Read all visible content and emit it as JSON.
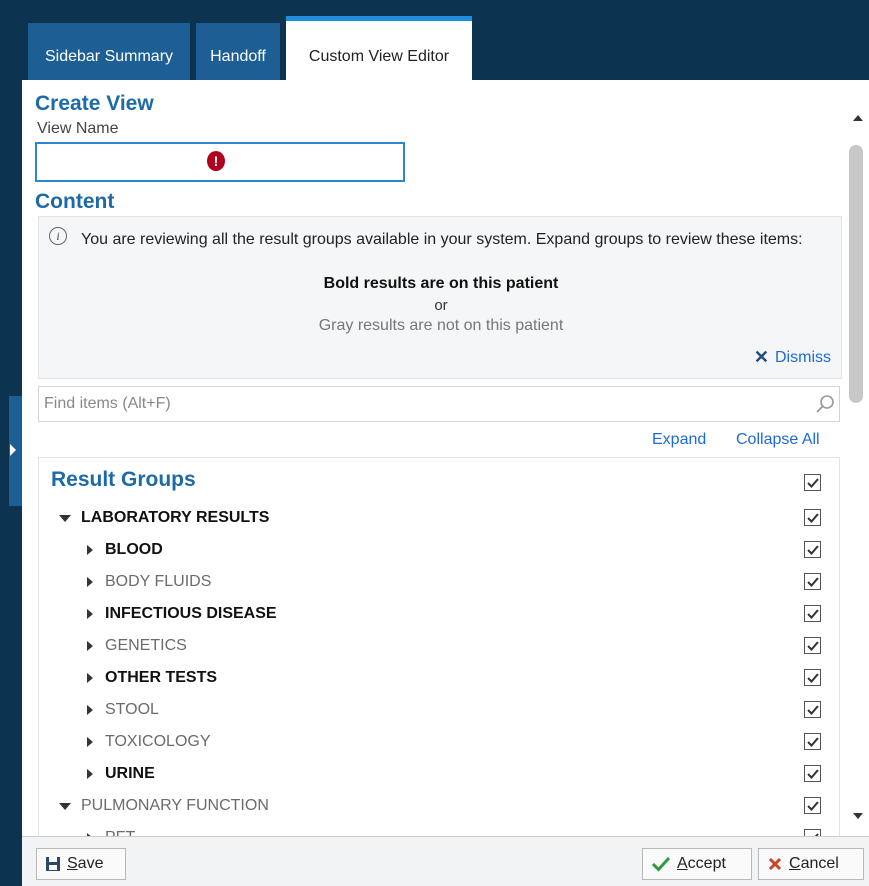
{
  "tabs": [
    {
      "label": "Sidebar Summary"
    },
    {
      "label": "Handoff"
    },
    {
      "label": "Custom View Editor"
    }
  ],
  "create_view": {
    "heading": "Create View",
    "view_name_label": "View Name",
    "view_name_value": "",
    "error_icon": "!"
  },
  "content": {
    "heading": "Content",
    "info_icon": "i",
    "info_text": "You are reviewing all the result groups available in your system. Expand groups to review these items:",
    "bold_note": "Bold results are on this patient",
    "or_text": "or",
    "gray_note": "Gray results are not on this patient",
    "dismiss_label": "Dismiss"
  },
  "search": {
    "placeholder": "Find items (Alt+F)"
  },
  "links": {
    "expand": "Expand",
    "collapse_all": "Collapse All"
  },
  "result_groups": {
    "title": "Result Groups",
    "items": [
      {
        "label": "LABORATORY RESULTS",
        "level": 0,
        "expanded": true,
        "bold": true,
        "checked": true
      },
      {
        "label": "BLOOD",
        "level": 1,
        "expanded": false,
        "bold": true,
        "checked": true
      },
      {
        "label": "BODY FLUIDS",
        "level": 1,
        "expanded": false,
        "bold": false,
        "checked": true
      },
      {
        "label": "INFECTIOUS DISEASE",
        "level": 1,
        "expanded": false,
        "bold": true,
        "checked": true
      },
      {
        "label": "GENETICS",
        "level": 1,
        "expanded": false,
        "bold": false,
        "checked": true
      },
      {
        "label": "OTHER TESTS",
        "level": 1,
        "expanded": false,
        "bold": true,
        "checked": true
      },
      {
        "label": "STOOL",
        "level": 1,
        "expanded": false,
        "bold": false,
        "checked": true
      },
      {
        "label": "TOXICOLOGY",
        "level": 1,
        "expanded": false,
        "bold": false,
        "checked": true
      },
      {
        "label": "URINE",
        "level": 1,
        "expanded": false,
        "bold": true,
        "checked": true
      },
      {
        "label": "PULMONARY FUNCTION",
        "level": 0,
        "expanded": true,
        "bold": false,
        "checked": true
      },
      {
        "label": "PFT",
        "level": 1,
        "expanded": false,
        "bold": false,
        "checked": true
      }
    ]
  },
  "footer": {
    "save_label": "Save",
    "save_underline": "S",
    "save_rest": "ave",
    "accept_underline": "A",
    "accept_rest": "ccept",
    "cancel_underline": "C",
    "cancel_rest": "ancel"
  },
  "colors": {
    "header_bg": "#0c3450",
    "tab_bg": "#1d5f95",
    "heading_blue": "#1d6aa8",
    "link_blue": "#1d6ad8",
    "accept_green": "#2e9a3a",
    "cancel_red": "#d0402a"
  }
}
